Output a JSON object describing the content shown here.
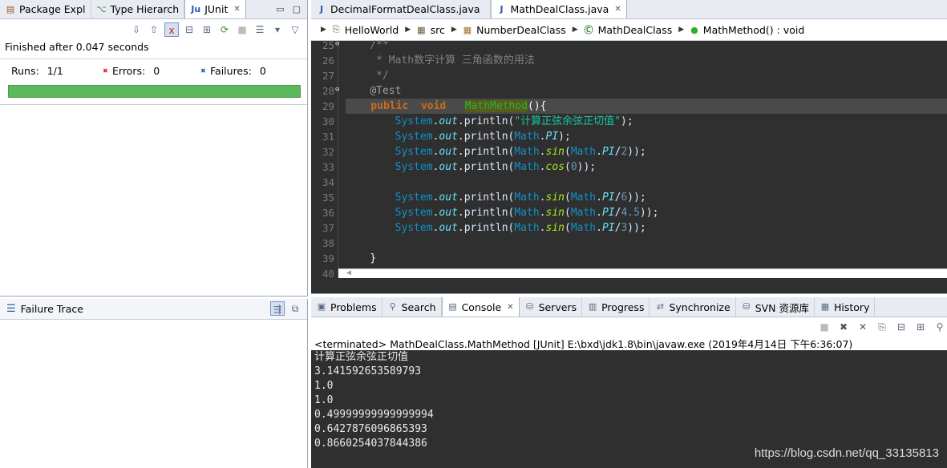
{
  "left_tabs": [
    {
      "label": "Package Expl",
      "icon": "package-explorer-icon"
    },
    {
      "label": "Type Hierarch",
      "icon": "type-hierarchy-icon"
    },
    {
      "label": "JUnit",
      "icon": "junit-icon",
      "active": true
    }
  ],
  "junit": {
    "finished": "Finished after 0.047 seconds",
    "runs_label": "Runs:",
    "runs_value": "1/1",
    "errors_label": "Errors:",
    "errors_value": "0",
    "failures_label": "Failures:",
    "failures_value": "0",
    "progress_color": "#5cb85c",
    "progress": 1.0
  },
  "failure_trace": {
    "label": "Failure Trace"
  },
  "editor_tabs": [
    {
      "label": "DecimalFormatDealClass.java",
      "icon": "java-file-icon"
    },
    {
      "label": "MathDealClass.java",
      "icon": "java-file-icon",
      "active": true
    }
  ],
  "breadcrumb": [
    {
      "label": "HelloWorld",
      "icon": "project-icon"
    },
    {
      "label": "src",
      "icon": "source-folder-icon"
    },
    {
      "label": "NumberDealClass",
      "icon": "package-icon"
    },
    {
      "label": "MathDealClass",
      "icon": "class-icon"
    },
    {
      "label": "MathMethod() : void",
      "icon": "method-icon"
    }
  ],
  "code_lines": [
    {
      "num": "25",
      "html": "    <span class=\"cm\">/**</span>"
    },
    {
      "num": "26",
      "html": "     <span class=\"cm\">* Math数字计算 三角函数的用法</span>"
    },
    {
      "num": "27",
      "html": "     <span class=\"cm\">*/</span>"
    },
    {
      "num": "28",
      "html": "    <span class=\"ann\">@Test</span>"
    },
    {
      "num": "29",
      "html": "    <span class=\"kw\">public</span>  <span class=\"kw\">void</span>   <span class=\"mdef\">MathMethod</span><span class=\"plain\">(){</span>",
      "hl": true
    },
    {
      "num": "30",
      "html": "        <span class=\"cls\">System</span>.<span class=\"fld\">out</span>.println(<span class=\"str\">\"计算正弦余弦正切值\"</span>);"
    },
    {
      "num": "31",
      "html": "        <span class=\"cls\">System</span>.<span class=\"fld\">out</span>.println(<span class=\"cls\">Math</span>.<span class=\"fld\">PI</span>);"
    },
    {
      "num": "32",
      "html": "        <span class=\"cls\">System</span>.<span class=\"fld\">out</span>.println(<span class=\"cls\">Math</span>.<span class=\"meth\">sin</span>(<span class=\"cls\">Math</span>.<span class=\"fld\">PI</span>/<span class=\"num\">2</span>));"
    },
    {
      "num": "33",
      "html": "        <span class=\"cls\">System</span>.<span class=\"fld\">out</span>.println(<span class=\"cls\">Math</span>.<span class=\"meth\">cos</span>(<span class=\"num\">0</span>));"
    },
    {
      "num": "34",
      "html": ""
    },
    {
      "num": "35",
      "html": "        <span class=\"cls\">System</span>.<span class=\"fld\">out</span>.println(<span class=\"cls\">Math</span>.<span class=\"meth\">sin</span>(<span class=\"cls\">Math</span>.<span class=\"fld\">PI</span>/<span class=\"num\">6</span>));"
    },
    {
      "num": "36",
      "html": "        <span class=\"cls\">System</span>.<span class=\"fld\">out</span>.println(<span class=\"cls\">Math</span>.<span class=\"meth\">sin</span>(<span class=\"cls\">Math</span>.<span class=\"fld\">PI</span>/<span class=\"num\">4.5</span>));"
    },
    {
      "num": "37",
      "html": "        <span class=\"cls\">System</span>.<span class=\"fld\">out</span>.println(<span class=\"cls\">Math</span>.<span class=\"meth\">sin</span>(<span class=\"cls\">Math</span>.<span class=\"fld\">PI</span>/<span class=\"num\">3</span>));"
    },
    {
      "num": "38",
      "html": ""
    },
    {
      "num": "39",
      "html": "    <span class=\"plain\">}</span>"
    },
    {
      "num": "40",
      "html": ""
    }
  ],
  "console_tabs": [
    {
      "label": "Problems",
      "icon": "problems-icon"
    },
    {
      "label": "Search",
      "icon": "search-icon"
    },
    {
      "label": "Console",
      "icon": "console-icon",
      "active": true
    },
    {
      "label": "Servers",
      "icon": "servers-icon"
    },
    {
      "label": "Progress",
      "icon": "progress-icon"
    },
    {
      "label": "Synchronize",
      "icon": "synchronize-icon"
    },
    {
      "label": "SVN 资源库",
      "icon": "svn-repository-icon"
    },
    {
      "label": "History",
      "icon": "history-icon"
    }
  ],
  "console": {
    "header": "<terminated> MathDealClass.MathMethod [JUnit] E:\\bxd\\jdk1.8\\bin\\javaw.exe (2019年4月14日 下午6:36:07)",
    "lines": [
      "计算正弦余弦正切值",
      "3.141592653589793",
      "1.0",
      "1.0",
      "0.49999999999999994",
      "0.6427876096865393",
      "0.8660254037844386"
    ]
  },
  "watermark": "https://blog.csdn.net/qq_33135813"
}
